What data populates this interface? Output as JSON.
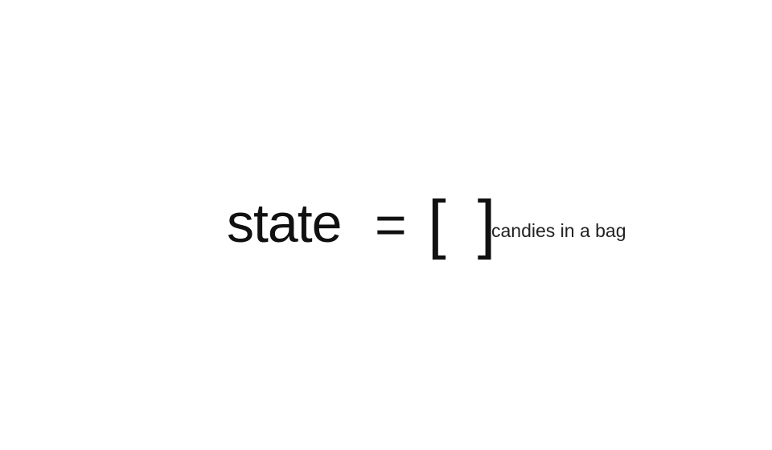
{
  "slide": {
    "term": "state",
    "operator": "=",
    "value": "[ ]",
    "caption": "candies in a bag"
  }
}
